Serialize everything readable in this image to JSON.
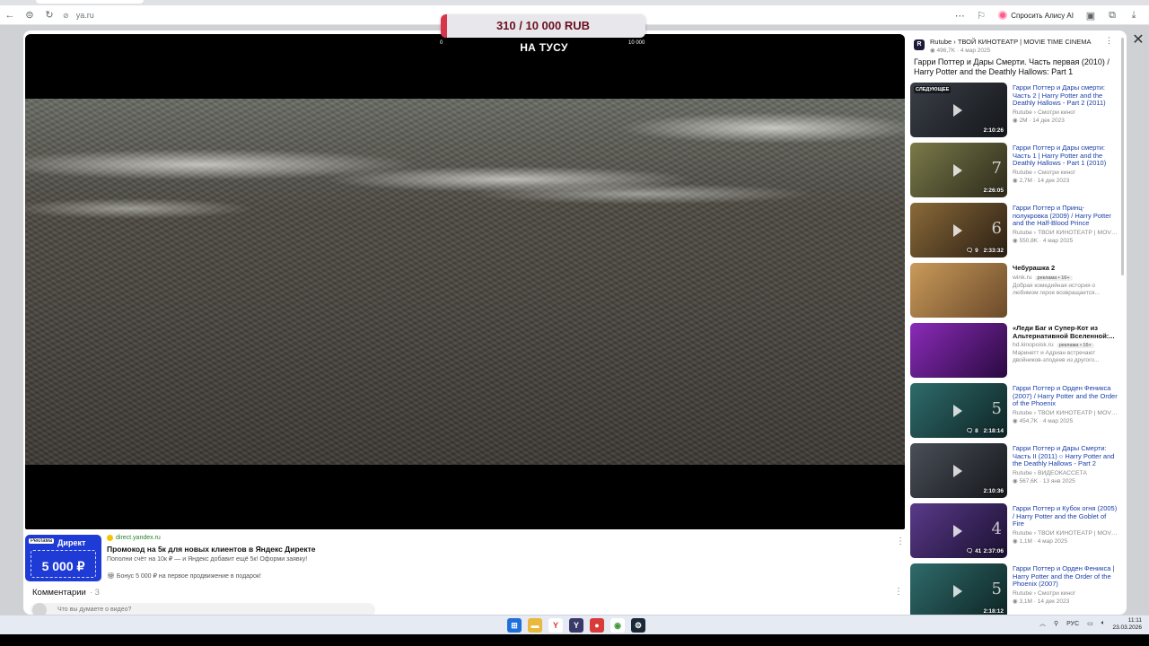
{
  "browser": {
    "url": "ya.ru",
    "alice_label": "Спросить Алису AI"
  },
  "donation": {
    "amount_text": "310 / 10 000 RUB",
    "progress": 0.031,
    "min_label": "0",
    "max_label": "10 000",
    "title": "НА ТУСУ",
    "fill_color": "#d8344a"
  },
  "ad": {
    "image_label": "Реклама",
    "image_brand": "Директ",
    "image_sum": "5 000 ₽",
    "domain": "direct.yandex.ru",
    "title": "Промокод на 5к для новых клиентов в Яндекс Директе",
    "text": "Пополни счёт на 10к ₽ — и Яндекс добавит ещё 5к! Оформи заявку!",
    "bonus": "Бонус 5 000 ₽ на первое продвижение в подарок!"
  },
  "comments": {
    "header": "Комментарии",
    "count": "3",
    "placeholder": "Что вы думаете о видео?"
  },
  "channel": {
    "logo_letter": "R",
    "name": "Rutube › ТВОЙ КИНОТЕАТР | MOVIE TIME CINEMA",
    "meta": "◉ 496,7K · 4 мар 2025",
    "video_title": "Гарри Поттер и Дары Смерти. Часть первая (2010) / Harry Potter and the Deathly Hallows: Part 1"
  },
  "recommendations": [
    {
      "title": "Гарри Поттер и Дары смерти: Часть 2 | Harry Potter and the Deathly Hallows - Part 2 (2011)",
      "channel": "Rutube › Смотри кино!",
      "meta": "◉ 2M · 14 дек 2023",
      "duration": "2:10:26",
      "badge": "СЛЕДУЮЩЕЕ",
      "comments": "",
      "big": "",
      "thumb_colors": [
        "#3a3f47",
        "#14161a"
      ],
      "is_ad": false
    },
    {
      "title": "Гарри Поттер и Дары смерти: Часть 1 | Harry Potter and the Deathly Hallows - Part 1 (2010)",
      "channel": "Rutube › Смотри кино!",
      "meta": "◉ 2,7M · 14 дек 2023",
      "duration": "2:26:05",
      "badge": "",
      "comments": "",
      "big": "7",
      "thumb_colors": [
        "#7a7a4a",
        "#2c2a1a"
      ],
      "is_ad": false
    },
    {
      "title": "Гарри Поттер и Принц-полукровка (2009) / Harry Potter and the Half-Blood Prince",
      "channel": "Rutube › ТВОЙ КИНОТЕАТР | MOVIE TIME CINEMA",
      "meta": "◉ 550,8K · 4 мар 2025",
      "duration": "2:33:32",
      "badge": "",
      "comments": "9",
      "big": "6",
      "thumb_colors": [
        "#8a6a3a",
        "#2a1e12"
      ],
      "is_ad": false
    },
    {
      "title": "Чебурашка 2",
      "channel": "wink.ru",
      "ad_badge": "реклама • 16+",
      "description": "Добрая комедийная история о любимом герое возвращается...",
      "meta": "",
      "duration": "",
      "badge": "",
      "comments": "",
      "big": "",
      "thumb_colors": [
        "#c99a5a",
        "#6b4a2a"
      ],
      "is_ad": true
    },
    {
      "title": "«Леди Баг и Супер-Кот из Альтернативной Вселенной:...",
      "channel": "hd.kinopoisk.ru",
      "ad_badge": "реклама • 16+",
      "description": "Маринетт и Адриан встречают двойников-злодеев из другого...",
      "meta": "",
      "duration": "",
      "badge": "",
      "comments": "",
      "big": "",
      "thumb_colors": [
        "#8a2bb8",
        "#2a0a40"
      ],
      "is_ad": true
    },
    {
      "title": "Гарри Поттер и Орден Феникса (2007) / Harry Potter and the Order of the Phoenix",
      "channel": "Rutube › ТВОЙ КИНОТЕАТР | MOVIE TIME CINEMA",
      "meta": "◉ 454,7K · 4 мар 2025",
      "duration": "2:18:14",
      "badge": "",
      "comments": "8",
      "big": "5",
      "thumb_colors": [
        "#2f6b6b",
        "#0e2424"
      ],
      "is_ad": false
    },
    {
      "title": "Гарри Поттер и Дары Смерти: Часть II (2011) ○ Harry Potter and the Deathly Hallows - Part 2",
      "channel": "Rutube › ВИДЕОКАССЕТА",
      "meta": "◉ 567,6K · 13 янв 2025",
      "duration": "2:10:36",
      "badge": "",
      "comments": "",
      "big": "",
      "thumb_colors": [
        "#4a4f58",
        "#15171b"
      ],
      "is_ad": false
    },
    {
      "title": "Гарри Поттер и Кубок огня (2005) / Harry Potter and the Goblet of Fire",
      "channel": "Rutube › ТВОЙ КИНОТЕАТР | MOVIE TIME CINEMA",
      "meta": "◉ 1,1M · 4 мар 2025",
      "duration": "2:37:06",
      "badge": "",
      "comments": "41",
      "big": "4",
      "thumb_colors": [
        "#5a3a8a",
        "#1a1030"
      ],
      "is_ad": false
    },
    {
      "title": "Гарри Поттер и Орден Феникса | Harry Potter and the Order of the Phoenix (2007)",
      "channel": "Rutube › Смотри кино!",
      "meta": "◉ 3,1M · 14 дек 2023",
      "duration": "2:18:12",
      "badge": "",
      "comments": "",
      "big": "5",
      "thumb_colors": [
        "#2f6b6b",
        "#0e2424"
      ],
      "is_ad": false
    }
  ],
  "taskbar": {
    "lang": "РУС",
    "time": "11:11",
    "date": "23.03.2026"
  }
}
